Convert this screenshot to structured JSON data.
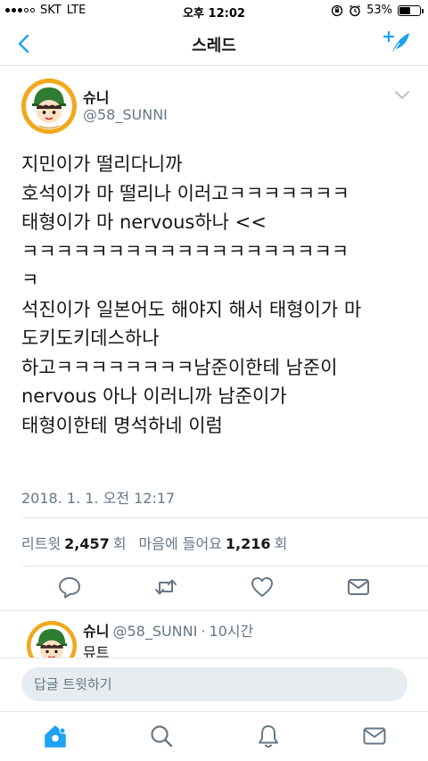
{
  "status_bar": {
    "carrier": "SKT",
    "network": "LTE",
    "time": "오후 12:02",
    "battery": "53%",
    "battery_level": 0.53
  },
  "nav": {
    "title": "스레드",
    "back_icon": "chevron-left-icon",
    "compose_icon": "compose-tweet-icon"
  },
  "tweet": {
    "name": "슈니",
    "handle": "@58_SUNNI",
    "lines": [
      "지민이가 떨리다니까",
      "호석이가 마 떨리나 이러고ㅋㅋㅋㅋㅋㅋㅋ",
      "태형이가 마 nervous하나 <<",
      "ㅋㅋㅋㅋㅋㅋㅋㅋㅋㅋㅋㅋㅋㅋㅋㅋㅋㅋㅋ",
      "ㅋ",
      "석진이가 일본어도 해야지 해서 태형이가 마",
      "도키도키데스하나",
      "하고ㅋㅋㅋㅋㅋㅋㅋㅋ남준이한테 남준이",
      "nervous 아나 이러니까 남준이가",
      "태형이한테 명석하네 이럼"
    ],
    "timestamp": "2018. 1. 1. 오전 12:17",
    "retweets_label": "리트윗",
    "retweets_count": "2,457",
    "retweets_unit": "회",
    "likes_label": "마음에 들어요",
    "likes_count": "1,216",
    "likes_unit": "회"
  },
  "reply": {
    "name": "슈니",
    "handle": "@58_SUNNI",
    "separator": "·",
    "time": "10시간",
    "text": "뮤트"
  },
  "composer": {
    "placeholder": "답글 트윗하기"
  },
  "colors": {
    "accent": "#1da1f2",
    "text": "#14171a",
    "secondary": "#657786",
    "divider": "#e1e8ed",
    "avatar_bg": "#f2a81d"
  }
}
